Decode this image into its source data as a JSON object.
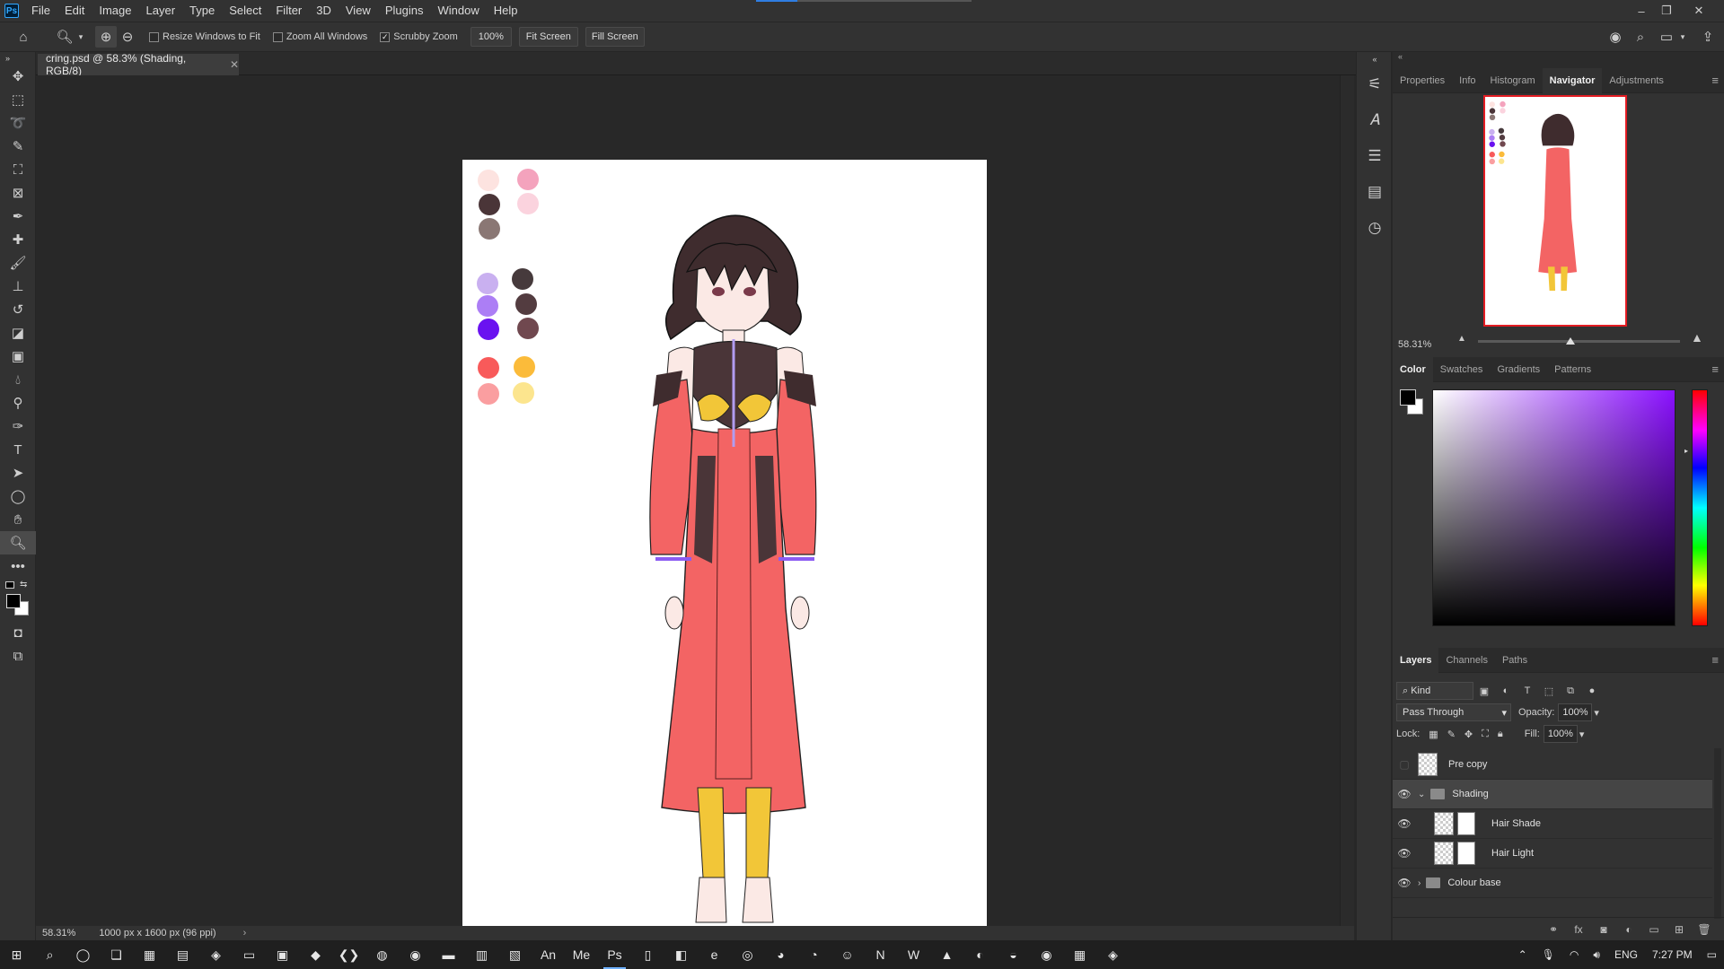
{
  "app": {
    "menu": [
      "File",
      "Edit",
      "Image",
      "Layer",
      "Type",
      "Select",
      "Filter",
      "3D",
      "View",
      "Plugins",
      "Window",
      "Help"
    ],
    "logo": "Ps"
  },
  "options": {
    "resize_windows": "Resize Windows to Fit",
    "zoom_all": "Zoom All Windows",
    "scrubby_zoom": "Scrubby Zoom",
    "zoom_value": "100%",
    "fit_screen": "Fit Screen",
    "fill_screen": "Fill Screen"
  },
  "document": {
    "tab_title": "cring.psd @ 58.3% (Shading, RGB/8)",
    "zoom_status": "58.31%",
    "size_status": "1000 px x 1600 px (96 ppi)"
  },
  "panels": {
    "top_tabs": [
      "Properties",
      "Info",
      "Histogram",
      "Navigator",
      "Adjustments"
    ],
    "active_top_tab": "Navigator",
    "navigator_zoom": "58.31%",
    "navigator_zoom_fraction": 0.58,
    "color_tabs": [
      "Color",
      "Swatches",
      "Gradients",
      "Patterns"
    ],
    "layers_tabs": [
      "Layers",
      "Channels",
      "Paths"
    ],
    "kind_label": "Kind",
    "blend_mode": "Pass Through",
    "opacity_label": "Opacity:",
    "opacity_value": "100%",
    "lock_label": "Lock:",
    "fill_label": "Fill:",
    "fill_value": "100%"
  },
  "layers": [
    {
      "name": "Pre copy",
      "visible": false,
      "kind": "layer"
    },
    {
      "name": "Shading",
      "visible": true,
      "kind": "group",
      "expanded": true,
      "selected": true
    },
    {
      "name": "Hair Shade",
      "visible": true,
      "kind": "layer-mask",
      "indent": true
    },
    {
      "name": "Hair Light",
      "visible": true,
      "kind": "layer-mask",
      "indent": true
    },
    {
      "name": "Colour base",
      "visible": true,
      "kind": "group"
    }
  ],
  "palette": {
    "colors": [
      "#fde3e0",
      "#f4a3bd",
      "#4a3538",
      "#fbd3de",
      "#8a7774",
      "#c9b0f0",
      "#463a3c",
      "#ac7ef5",
      "#533c40",
      "#6a12f0",
      "#70484f",
      "#f85a5a",
      "#fbbb3a",
      "#fa9ea0",
      "#fce58e"
    ]
  },
  "taskbar": {
    "language": "ENG",
    "time": "7:27 PM"
  },
  "colors": {
    "foreground": "#000000",
    "background": "#ffffff",
    "accent": "#31a8ff",
    "dress": "#f36464"
  }
}
